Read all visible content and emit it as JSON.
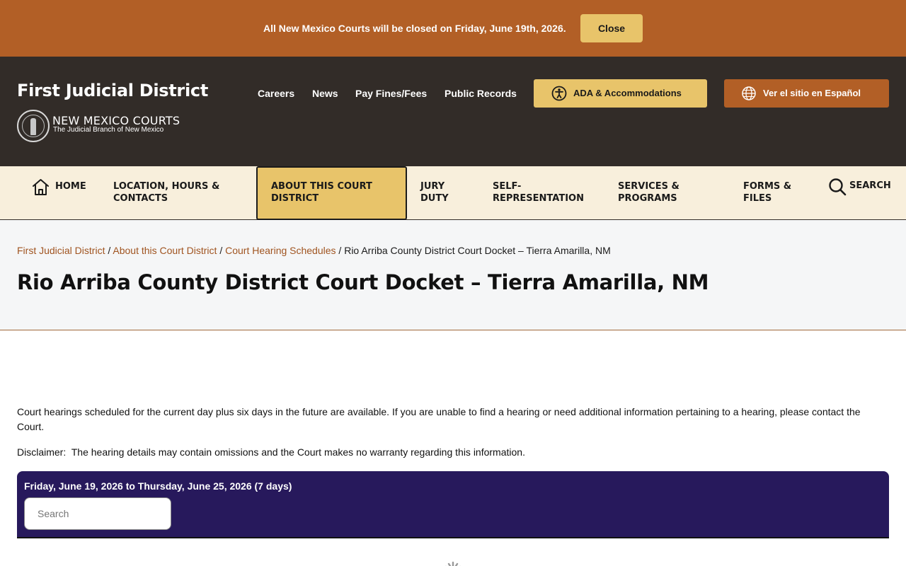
{
  "alert": {
    "message": "All New Mexico Courts will be closed on Friday, June 19th, 2026.",
    "close_label": "Close"
  },
  "header": {
    "site_title": "First Judicial District",
    "courts_name": "NEW MEXICO COURTS",
    "courts_tagline": "The Judicial Branch of New Mexico",
    "links": [
      "Careers",
      "News",
      "Pay Fines/Fees",
      "Public Records"
    ],
    "ada_label": "ADA & Accommodations",
    "spanish_label": "Ver el sitio en Español"
  },
  "nav": {
    "home": "HOME",
    "location": "LOCATION, HOURS & CONTACTS",
    "about": "ABOUT THIS COURT DISTRICT",
    "jury": "JURY DUTY",
    "self_rep": "SELF-REPRESENTATION",
    "services": "SERVICES & PROGRAMS",
    "forms": "FORMS & FILES",
    "search": "SEARCH"
  },
  "breadcrumb": {
    "items": [
      "First Judicial District",
      "About this Court District",
      "Court Hearing Schedules"
    ],
    "separator": " / ",
    "current": "Rio Arriba County District Court Docket – Tierra Amarilla, NM"
  },
  "page_title": "Rio Arriba County District Court Docket – Tierra Amarilla, NM",
  "content": {
    "intro": "Court hearings scheduled for the current day plus six days in the future are available. If you are unable to find a hearing or need additional information pertaining to a hearing, please contact the Court.",
    "disclaimer": "Disclaimer:  The hearing details may contain omissions and the Court makes no warranty regarding this information."
  },
  "docket": {
    "date_range": "Friday, June 19, 2026 to Thursday, June 25, 2026 (7 days)",
    "search_placeholder": "Search",
    "search_value": ""
  },
  "colors": {
    "alert_bg": "#b25f26",
    "header_bg": "#322c28",
    "accent_gold": "#e8c46a",
    "nav_bg": "#f8efdc",
    "docket_bg": "#27195c",
    "link": "#a05420"
  },
  "icons": [
    "accessibility-icon",
    "globe-icon",
    "home-icon",
    "search-icon",
    "court-seal-logo",
    "loading-spinner-icon"
  ]
}
